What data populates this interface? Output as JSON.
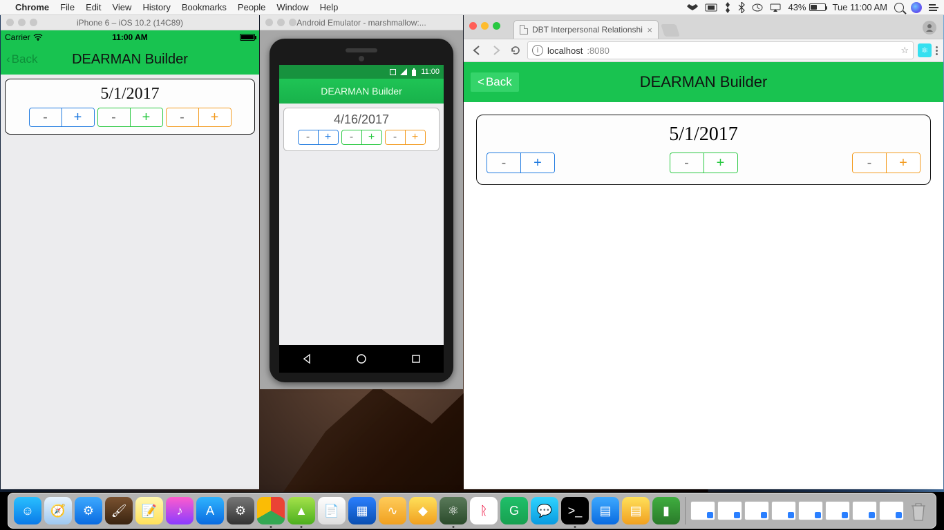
{
  "mac": {
    "app": "Chrome",
    "menus": [
      "File",
      "Edit",
      "View",
      "History",
      "Bookmarks",
      "People",
      "Window",
      "Help"
    ],
    "battery_pct": "43%",
    "battery_fill_pct": 43,
    "clock": "Tue 11:00 AM"
  },
  "colors": {
    "brand_green": "#18c350",
    "stepper_blue": "#1f7ae0",
    "stepper_green": "#28c840",
    "stepper_orange": "#f39b1f"
  },
  "ios_sim": {
    "window_title": "iPhone 6 – iOS 10.2 (14C89)",
    "carrier": "Carrier",
    "status_time": "11:00 AM",
    "back_label": "Back",
    "nav_title": "DEARMAN Builder",
    "card_date": "5/1/2017",
    "steppers": [
      {
        "minus": "-",
        "plus": "+",
        "style": "blue"
      },
      {
        "minus": "-",
        "plus": "+",
        "style": "green"
      },
      {
        "minus": "-",
        "plus": "+",
        "style": "orange"
      }
    ]
  },
  "android_emu": {
    "window_title": "Android Emulator - marshmallow:...",
    "status_time": "11:00",
    "nav_title": "DEARMAN Builder",
    "card_date": "4/16/2017",
    "steppers": [
      {
        "minus": "-",
        "plus": "+",
        "style": "blue"
      },
      {
        "minus": "-",
        "plus": "+",
        "style": "green"
      },
      {
        "minus": "-",
        "plus": "+",
        "style": "orange"
      }
    ]
  },
  "chrome": {
    "tab_title": "DBT Interpersonal Relationshi",
    "url_host": "localhost",
    "url_port": ":8080",
    "back_label": "Back",
    "nav_title": "DEARMAN Builder",
    "card_date": "5/1/2017",
    "steppers": [
      {
        "minus": "-",
        "plus": "+",
        "style": "blue"
      },
      {
        "minus": "-",
        "plus": "+",
        "style": "green"
      },
      {
        "minus": "-",
        "plus": "+",
        "style": "orange"
      }
    ]
  },
  "dock": {
    "apps": [
      {
        "name": "finder",
        "bg": "linear-gradient(#29c0ff,#0a7ae8)",
        "glyph": "☺"
      },
      {
        "name": "safari",
        "bg": "linear-gradient(#e8f4ff,#9ec8f0)",
        "glyph": "🧭"
      },
      {
        "name": "xcode",
        "bg": "linear-gradient(#3da9ff,#0a6be0)",
        "glyph": "⚙"
      },
      {
        "name": "xcode2",
        "bg": "linear-gradient(#7a5230,#3a2410)",
        "glyph": "🖌"
      },
      {
        "name": "notes",
        "bg": "linear-gradient(#fff8b0,#ffe05a)",
        "glyph": "📝"
      },
      {
        "name": "itunes",
        "bg": "linear-gradient(#ff5ccd,#8a3cff)",
        "glyph": "♪"
      },
      {
        "name": "appstore",
        "bg": "linear-gradient(#2fb4ff,#0a6be0)",
        "glyph": "A"
      },
      {
        "name": "settings",
        "bg": "linear-gradient(#777,#333)",
        "glyph": "⚙"
      },
      {
        "name": "chrome",
        "bg": "conic-gradient(#ea4335 0 120deg,#34a853 120deg 240deg,#fbbc05 240deg 360deg)",
        "glyph": "",
        "dot": true
      },
      {
        "name": "androidstudio",
        "bg": "linear-gradient(#a4e24a,#4caf1f)",
        "glyph": "▲",
        "dot": true
      },
      {
        "name": "pages",
        "bg": "linear-gradient(#fff,#ddd)",
        "glyph": "📄"
      },
      {
        "name": "keynote",
        "bg": "linear-gradient(#2a7fff,#0a4fb0)",
        "glyph": "▦"
      },
      {
        "name": "audacity",
        "bg": "linear-gradient(#ffcc5a,#f0a020)",
        "glyph": "∿"
      },
      {
        "name": "sketch",
        "bg": "linear-gradient(#ffe05a,#f0a020)",
        "glyph": "◆"
      },
      {
        "name": "atom",
        "bg": "linear-gradient(#5a7a5a,#2a4a2a)",
        "glyph": "⚛",
        "dot": true
      },
      {
        "name": "gitkraken",
        "bg": "#fff",
        "glyph": "ᚱ",
        "fg": "#e03"
      },
      {
        "name": "grammarly",
        "bg": "linear-gradient(#1fc06a,#18a050)",
        "glyph": "G"
      },
      {
        "name": "messages",
        "bg": "linear-gradient(#2fd4ff,#0a9be0)",
        "glyph": "💬"
      },
      {
        "name": "terminal",
        "bg": "#000",
        "glyph": ">_",
        "dot": true
      },
      {
        "name": "xcode3",
        "bg": "linear-gradient(#3da9ff,#0a6be0)",
        "glyph": "▤"
      },
      {
        "name": "numbers",
        "bg": "linear-gradient(#ffe05a,#f0a020)",
        "glyph": "▤"
      },
      {
        "name": "books",
        "bg": "linear-gradient(#3fae3f,#2a7a2a)",
        "glyph": "▮"
      }
    ],
    "minis_count": 8
  }
}
